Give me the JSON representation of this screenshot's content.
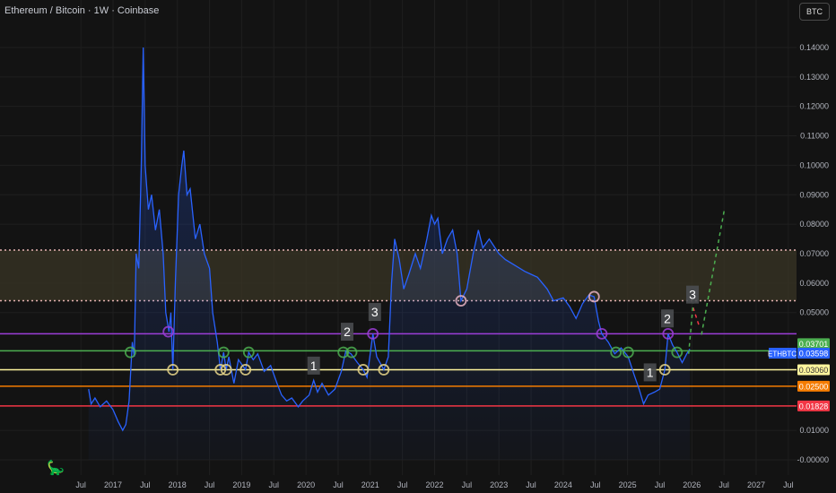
{
  "header": {
    "title": "Ethereum / Bitcoin · 1W · Coinbase",
    "currency_button": "BTC"
  },
  "logo_icon": "tradingview-dino-icon",
  "chart_data": {
    "type": "line",
    "title": "Ethereum / Bitcoin · 1W · Coinbase",
    "symbol": "ETHBTC",
    "ylim": [
      0,
      0.145
    ],
    "xlim": [
      2016.5,
      2027.6
    ],
    "y_ticks": [
      "0.14000",
      "0.13000",
      "0.12000",
      "0.11000",
      "0.10000",
      "0.09000",
      "0.08000",
      "0.07000",
      "0.06000",
      "0.05000",
      "0.01000",
      "-0.00000"
    ],
    "y_tick_values": [
      0.14,
      0.13,
      0.12,
      0.11,
      0.1,
      0.09,
      0.08,
      0.07,
      0.06,
      0.05,
      0.01,
      0
    ],
    "x_ticks": [
      {
        "label": "Jul",
        "x": 2016.5
      },
      {
        "label": "2017",
        "x": 2017
      },
      {
        "label": "Jul",
        "x": 2017.5
      },
      {
        "label": "2018",
        "x": 2018
      },
      {
        "label": "Jul",
        "x": 2018.5
      },
      {
        "label": "2019",
        "x": 2019
      },
      {
        "label": "Jul",
        "x": 2019.5
      },
      {
        "label": "2020",
        "x": 2020
      },
      {
        "label": "Jul",
        "x": 2020.5
      },
      {
        "label": "2021",
        "x": 2021
      },
      {
        "label": "Jul",
        "x": 2021.5
      },
      {
        "label": "2022",
        "x": 2022
      },
      {
        "label": "Jul",
        "x": 2022.5
      },
      {
        "label": "2023",
        "x": 2023
      },
      {
        "label": "Jul",
        "x": 2023.5
      },
      {
        "label": "2024",
        "x": 2024
      },
      {
        "label": "Jul",
        "x": 2024.5
      },
      {
        "label": "2025",
        "x": 2025
      },
      {
        "label": "Jul",
        "x": 2025.5
      },
      {
        "label": "2026",
        "x": 2026
      },
      {
        "label": "Jul",
        "x": 2026.5
      },
      {
        "label": "2027",
        "x": 2027
      },
      {
        "label": "Jul",
        "x": 2027.5
      }
    ],
    "series": [
      {
        "name": "ETHBTC",
        "color": "#2962ff",
        "points": [
          [
            2016.62,
            0.024
          ],
          [
            2016.66,
            0.019
          ],
          [
            2016.72,
            0.021
          ],
          [
            2016.8,
            0.018
          ],
          [
            2016.9,
            0.02
          ],
          [
            2017.0,
            0.017
          ],
          [
            2017.08,
            0.013
          ],
          [
            2017.15,
            0.01
          ],
          [
            2017.2,
            0.012
          ],
          [
            2017.25,
            0.02
          ],
          [
            2017.3,
            0.04
          ],
          [
            2017.33,
            0.035
          ],
          [
            2017.36,
            0.07
          ],
          [
            2017.4,
            0.065
          ],
          [
            2017.44,
            0.1
          ],
          [
            2017.47,
            0.14
          ],
          [
            2017.5,
            0.1
          ],
          [
            2017.55,
            0.085
          ],
          [
            2017.6,
            0.09
          ],
          [
            2017.66,
            0.078
          ],
          [
            2017.72,
            0.085
          ],
          [
            2017.78,
            0.07
          ],
          [
            2017.82,
            0.05
          ],
          [
            2017.87,
            0.0435
          ],
          [
            2017.9,
            0.05
          ],
          [
            2017.93,
            0.0306
          ],
          [
            2017.97,
            0.06
          ],
          [
            2018.02,
            0.09
          ],
          [
            2018.07,
            0.1
          ],
          [
            2018.1,
            0.105
          ],
          [
            2018.15,
            0.09
          ],
          [
            2018.2,
            0.092
          ],
          [
            2018.28,
            0.075
          ],
          [
            2018.35,
            0.08
          ],
          [
            2018.42,
            0.07
          ],
          [
            2018.5,
            0.065
          ],
          [
            2018.55,
            0.05
          ],
          [
            2018.62,
            0.04
          ],
          [
            2018.67,
            0.0306
          ],
          [
            2018.72,
            0.0365
          ],
          [
            2018.76,
            0.0306
          ],
          [
            2018.8,
            0.035
          ],
          [
            2018.88,
            0.026
          ],
          [
            2018.95,
            0.034
          ],
          [
            2019.06,
            0.0306
          ],
          [
            2019.11,
            0.0365
          ],
          [
            2019.18,
            0.034
          ],
          [
            2019.25,
            0.036
          ],
          [
            2019.35,
            0.03
          ],
          [
            2019.45,
            0.032
          ],
          [
            2019.55,
            0.026
          ],
          [
            2019.62,
            0.022
          ],
          [
            2019.7,
            0.02
          ],
          [
            2019.78,
            0.021
          ],
          [
            2019.88,
            0.018
          ],
          [
            2019.95,
            0.02
          ],
          [
            2020.05,
            0.022
          ],
          [
            2020.12,
            0.027
          ],
          [
            2020.18,
            0.023
          ],
          [
            2020.25,
            0.026
          ],
          [
            2020.35,
            0.022
          ],
          [
            2020.45,
            0.024
          ],
          [
            2020.55,
            0.03
          ],
          [
            2020.62,
            0.037
          ],
          [
            2020.7,
            0.036
          ],
          [
            2020.8,
            0.033
          ],
          [
            2020.89,
            0.0306
          ],
          [
            2020.95,
            0.028
          ],
          [
            2021.04,
            0.0428
          ],
          [
            2021.1,
            0.035
          ],
          [
            2021.21,
            0.0306
          ],
          [
            2021.28,
            0.035
          ],
          [
            2021.33,
            0.06
          ],
          [
            2021.38,
            0.075
          ],
          [
            2021.45,
            0.068
          ],
          [
            2021.52,
            0.058
          ],
          [
            2021.6,
            0.063
          ],
          [
            2021.7,
            0.07
          ],
          [
            2021.78,
            0.065
          ],
          [
            2021.88,
            0.075
          ],
          [
            2021.95,
            0.083
          ],
          [
            2022.0,
            0.08
          ],
          [
            2022.05,
            0.082
          ],
          [
            2022.12,
            0.07
          ],
          [
            2022.2,
            0.075
          ],
          [
            2022.28,
            0.078
          ],
          [
            2022.35,
            0.07
          ],
          [
            2022.41,
            0.054
          ],
          [
            2022.5,
            0.058
          ],
          [
            2022.6,
            0.07
          ],
          [
            2022.68,
            0.078
          ],
          [
            2022.75,
            0.072
          ],
          [
            2022.85,
            0.075
          ],
          [
            2023.0,
            0.07
          ],
          [
            2023.1,
            0.068
          ],
          [
            2023.25,
            0.066
          ],
          [
            2023.4,
            0.064
          ],
          [
            2023.5,
            0.063
          ],
          [
            2023.6,
            0.062
          ],
          [
            2023.75,
            0.058
          ],
          [
            2023.85,
            0.054
          ],
          [
            2024.0,
            0.055
          ],
          [
            2024.1,
            0.052
          ],
          [
            2024.2,
            0.048
          ],
          [
            2024.3,
            0.053
          ],
          [
            2024.4,
            0.056
          ],
          [
            2024.48,
            0.0554
          ],
          [
            2024.55,
            0.047
          ],
          [
            2024.6,
            0.0428
          ],
          [
            2024.7,
            0.04
          ],
          [
            2024.8,
            0.036
          ],
          [
            2024.9,
            0.038
          ],
          [
            2025.01,
            0.035
          ],
          [
            2025.1,
            0.029
          ],
          [
            2025.18,
            0.024
          ],
          [
            2025.25,
            0.019
          ],
          [
            2025.32,
            0.022
          ],
          [
            2025.42,
            0.023
          ],
          [
            2025.5,
            0.024
          ],
          [
            2025.58,
            0.0306
          ],
          [
            2025.63,
            0.0428
          ],
          [
            2025.7,
            0.039
          ],
          [
            2025.77,
            0.0365
          ],
          [
            2025.85,
            0.033
          ],
          [
            2025.92,
            0.036
          ],
          [
            2025.97,
            0.0376
          ]
        ]
      }
    ],
    "levels": [
      {
        "name": "purple",
        "price": 0.0428,
        "color": "#9c3dd8"
      },
      {
        "name": "green",
        "price": 0.03701,
        "color": "#4caf50",
        "label": "0.03701"
      },
      {
        "name": "yellow",
        "price": 0.0306,
        "color": "#fff59d",
        "label": "0.03060"
      },
      {
        "name": "orange",
        "price": 0.025,
        "color": "#f57c00",
        "label": "0.02500"
      },
      {
        "name": "red",
        "price": 0.01828,
        "color": "#f23645",
        "label": "0.01828"
      }
    ],
    "zone": {
      "top": 0.0712,
      "bottom": 0.054,
      "fill": "#3a3526",
      "border": "#e7b3b3"
    },
    "last_price": {
      "symbol": "ETHBTC",
      "value": "0.03598",
      "color": "#2962ff"
    },
    "markers": [
      {
        "x": 2017.27,
        "y": 0.0365,
        "color": "#4caf50"
      },
      {
        "x": 2017.86,
        "y": 0.0435,
        "color": "#9c3dd8"
      },
      {
        "x": 2017.93,
        "y": 0.0306,
        "color": "#e6d58a"
      },
      {
        "x": 2018.67,
        "y": 0.0306,
        "color": "#e6d58a"
      },
      {
        "x": 2018.76,
        "y": 0.0306,
        "color": "#e6d58a"
      },
      {
        "x": 2018.72,
        "y": 0.0365,
        "color": "#4caf50"
      },
      {
        "x": 2019.11,
        "y": 0.0365,
        "color": "#4caf50"
      },
      {
        "x": 2019.06,
        "y": 0.0306,
        "color": "#e6d58a"
      },
      {
        "x": 2020.58,
        "y": 0.0365,
        "color": "#4caf50"
      },
      {
        "x": 2020.71,
        "y": 0.0365,
        "color": "#4caf50"
      },
      {
        "x": 2020.89,
        "y": 0.0306,
        "color": "#e6d58a"
      },
      {
        "x": 2021.04,
        "y": 0.0428,
        "color": "#9c3dd8"
      },
      {
        "x": 2021.21,
        "y": 0.0306,
        "color": "#e6d58a"
      },
      {
        "x": 2022.41,
        "y": 0.054,
        "color": "#e7b3c3"
      },
      {
        "x": 2024.48,
        "y": 0.0554,
        "color": "#e7b3c3"
      },
      {
        "x": 2024.6,
        "y": 0.0428,
        "color": "#9c3dd8"
      },
      {
        "x": 2024.82,
        "y": 0.0365,
        "color": "#4caf50"
      },
      {
        "x": 2025.01,
        "y": 0.0365,
        "color": "#4caf50"
      },
      {
        "x": 2025.58,
        "y": 0.0306,
        "color": "#e6d58a"
      },
      {
        "x": 2025.63,
        "y": 0.0428,
        "color": "#9c3dd8"
      },
      {
        "x": 2025.77,
        "y": 0.0365,
        "color": "#4caf50"
      }
    ],
    "annotations": [
      {
        "text": "1",
        "x": 2020.12,
        "y": 0.032
      },
      {
        "text": "2",
        "x": 2020.64,
        "y": 0.0435
      },
      {
        "text": "3",
        "x": 2021.07,
        "y": 0.0502
      },
      {
        "text": "1",
        "x": 2025.35,
        "y": 0.0297
      },
      {
        "text": "2",
        "x": 2025.62,
        "y": 0.048
      },
      {
        "text": "3",
        "x": 2026.01,
        "y": 0.0561
      }
    ],
    "projections": [
      {
        "color": "#f23645",
        "points": [
          [
            2026.02,
            0.0517
          ],
          [
            2026.12,
            0.045
          ]
        ]
      },
      {
        "color": "#4caf50",
        "points": [
          [
            2025.95,
            0.036
          ],
          [
            2026.02,
            0.053
          ]
        ]
      },
      {
        "color": "#4caf50",
        "points": [
          [
            2026.15,
            0.0425
          ],
          [
            2026.51,
            0.0855
          ]
        ]
      }
    ]
  }
}
